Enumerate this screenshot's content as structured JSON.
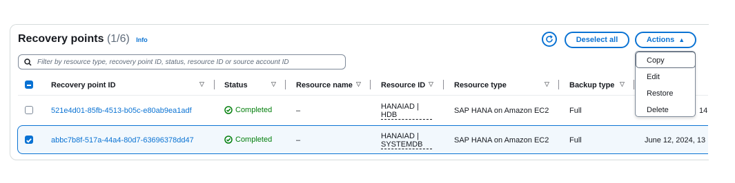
{
  "header": {
    "title": "Recovery points",
    "count": "(1/6)",
    "info": "Info",
    "deselect_label": "Deselect all",
    "actions_label": "Actions"
  },
  "search": {
    "placeholder": "Filter by resource type, recovery point ID, status, resource ID or source account ID"
  },
  "columns": [
    "Recovery point ID",
    "Status",
    "Resource name",
    "Resource ID",
    "Resource type",
    "Backup type"
  ],
  "rows": [
    {
      "selected": false,
      "id": "521e4d01-85fb-4513-b05c-e80ab9ea1adf",
      "status": "Completed",
      "resource_name": "–",
      "resource_id_1": "HANAIAD |",
      "resource_id_2": "HDB",
      "resource_type": "SAP HANA on Amazon EC2",
      "backup_type": "Full",
      "date": "14"
    },
    {
      "selected": true,
      "id": "abbc7b8f-517a-44a4-80d7-63696378dd47",
      "status": "Completed",
      "resource_name": "–",
      "resource_id_1": "HANAIAD |",
      "resource_id_2": "SYSTEMDB",
      "resource_type": "SAP HANA on Amazon EC2",
      "backup_type": "Full",
      "date": "June 12, 2024, 13"
    }
  ],
  "actions_menu": [
    "Copy",
    "Edit",
    "Restore",
    "Delete"
  ],
  "colors": {
    "accent": "#0972d3",
    "success": "#037f0c"
  }
}
